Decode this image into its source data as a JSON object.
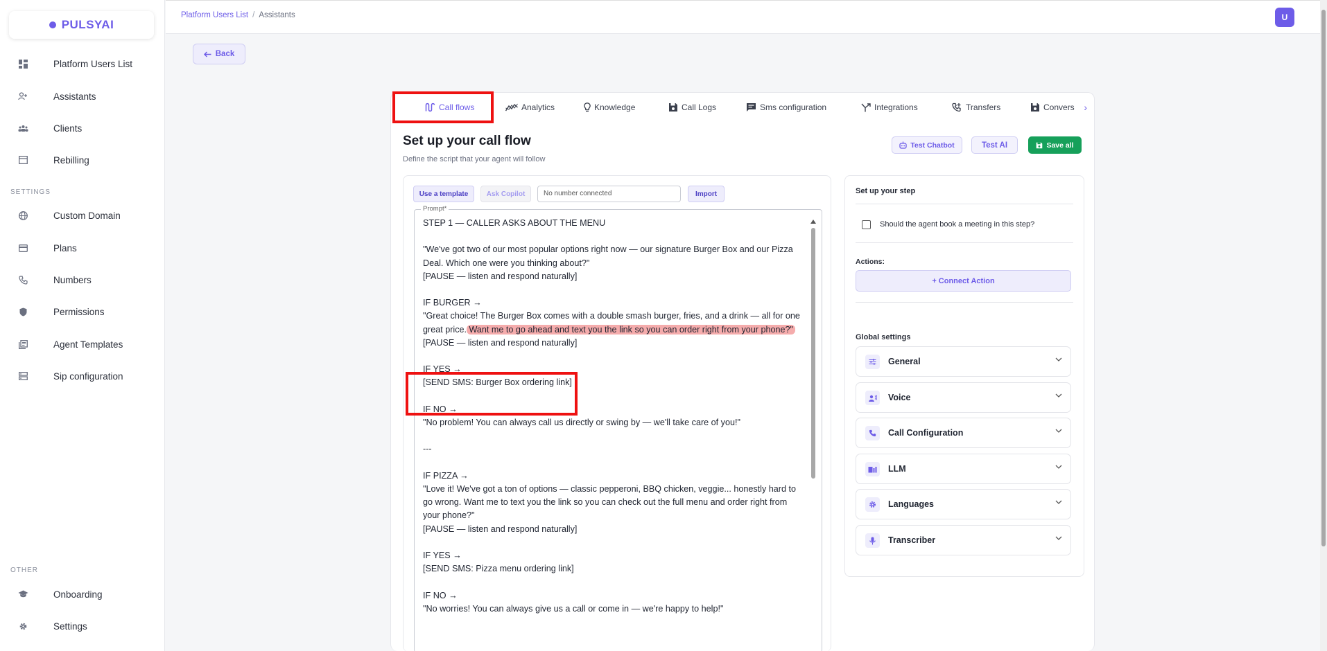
{
  "brand": {
    "name": "PULSYAI",
    "color": "#6d5ce8"
  },
  "sidebar": {
    "main_items": [
      {
        "label": "Platform Users List",
        "icon": "dashboard-icon"
      },
      {
        "label": "Assistants",
        "icon": "user-add-icon"
      },
      {
        "label": "Clients",
        "icon": "people-icon"
      },
      {
        "label": "Rebilling",
        "icon": "store-icon"
      }
    ],
    "settings_label": "SETTINGS",
    "settings_items": [
      {
        "label": "Custom Domain",
        "icon": "globe-icon"
      },
      {
        "label": "Plans",
        "icon": "credit-card-icon"
      },
      {
        "label": "Numbers",
        "icon": "phone-icon"
      },
      {
        "label": "Permissions",
        "icon": "shield-icon"
      },
      {
        "label": "Agent Templates",
        "icon": "library-icon"
      },
      {
        "label": "Sip configuration",
        "icon": "server-icon"
      }
    ],
    "other_label": "OTHER",
    "other_items": [
      {
        "label": "Onboarding",
        "icon": "graduation-cap-icon"
      },
      {
        "label": "Settings",
        "icon": "gear-icon"
      }
    ]
  },
  "header": {
    "breadcrumb_link": "Platform Users List",
    "breadcrumb_sep": "/",
    "breadcrumb_current": "Assistants",
    "avatar_initial": "U"
  },
  "back_label": "Back",
  "tabs": [
    {
      "label": "Call flows",
      "icon": "flow-icon",
      "active": true
    },
    {
      "label": "Analytics",
      "icon": "chart-line-icon"
    },
    {
      "label": "Knowledge",
      "icon": "lightbulb-icon"
    },
    {
      "label": "Call Logs",
      "icon": "save-icon"
    },
    {
      "label": "Sms configuration",
      "icon": "message-icon"
    },
    {
      "label": "Integrations",
      "icon": "merge-icon"
    },
    {
      "label": "Transfers",
      "icon": "phone-forward-icon"
    },
    {
      "label": "Convers",
      "icon": "save-icon"
    }
  ],
  "callflow": {
    "title": "Set up your call flow",
    "subtitle": "Define the script that your agent will follow",
    "test_chatbot": "Test Chatbot",
    "test_ai": "Test AI",
    "save_all": "Save all"
  },
  "prompt_panel": {
    "use_template": "Use a template",
    "ask_copilot": "Ask Copilot",
    "number_placeholder": "No number connected",
    "import": "Import",
    "legend": "Prompt*",
    "lines": {
      "l1": "STEP 1 — CALLER ASKS ABOUT THE MENU",
      "l2": "\"We've got two of our most popular options right now — our signature Burger Box and our Pizza Deal. Which one were you thinking about?\"",
      "l3": "[PAUSE — listen and respond naturally]",
      "l4": "IF BURGER →",
      "l5a": "\"Great choice! The Burger Box comes with a double smash burger, fries, and a drink — all for one great price.",
      "l5b": " Want me to go ahead and text you the link so you can order right from your phone?\" ",
      "l6": "[PAUSE — listen and respond naturally]",
      "l7": "IF YES →",
      "l8": "[SEND SMS: Burger Box ordering link]",
      "l9": "IF NO →",
      "l10": "\"No problem! You can always call us directly or swing by — we'll take care of you!\"",
      "l11": "---",
      "l12": "IF PIZZA →",
      "l13": "\"Love it! We've got a ton of options — classic pepperoni, BBQ chicken, veggie... honestly hard to go wrong. Want me to text you the link so you can check out the full menu and order right from your phone?\"",
      "l14": "[PAUSE — listen and respond naturally]",
      "l15": "IF YES →",
      "l16": "[SEND SMS: Pizza menu ordering link]",
      "l17": "IF NO →",
      "l18": "\"No worries! You can always give us a call or come in — we're happy to help!\""
    }
  },
  "step_panel": {
    "title": "Set up your step",
    "checkbox_label": "Should the agent book a meeting in this step?",
    "actions_label": "Actions:",
    "connect_action": "+ Connect Action",
    "global_settings": "Global settings",
    "accordions": [
      {
        "label": "General",
        "icon": "sliders-icon"
      },
      {
        "label": "Voice",
        "icon": "voice-icon"
      },
      {
        "label": "Call Configuration",
        "icon": "phone-icon"
      },
      {
        "label": "LLM",
        "icon": "llm-icon"
      },
      {
        "label": "Languages",
        "icon": "gear-icon"
      },
      {
        "label": "Transcriber",
        "icon": "microphone-icon"
      }
    ]
  }
}
